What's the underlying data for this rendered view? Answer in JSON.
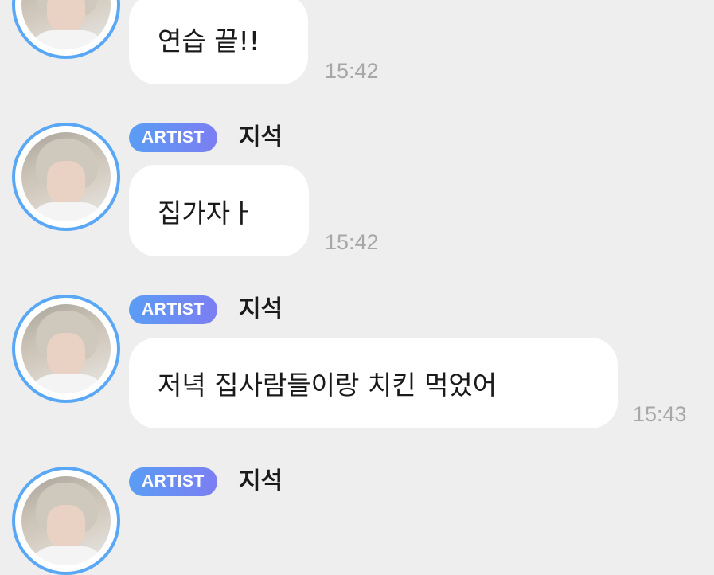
{
  "chat": {
    "messages": [
      {
        "sender_badge": "",
        "sender_name": "",
        "text": "연습 끝!!",
        "time": "15:42"
      },
      {
        "sender_badge": "ARTIST",
        "sender_name": "지석",
        "text": "집가자ㅏ",
        "time": "15:42"
      },
      {
        "sender_badge": "ARTIST",
        "sender_name": "지석",
        "text": "저녁 집사람들이랑 치킨 먹었어",
        "time": "15:43"
      },
      {
        "sender_badge": "ARTIST",
        "sender_name": "지석",
        "text": "",
        "time": ""
      }
    ]
  },
  "colors": {
    "background": "#eeeeee",
    "bubble": "#ffffff",
    "avatar_ring": "#5aa8f5",
    "badge_gradient_start": "#5a9df5",
    "badge_gradient_end": "#7c7ef2",
    "timestamp": "#a7a7a7"
  }
}
